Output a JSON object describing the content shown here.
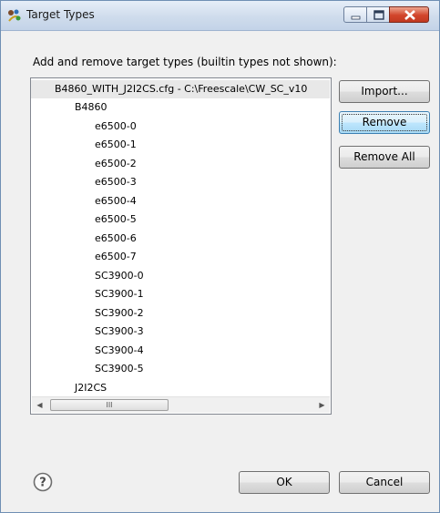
{
  "window": {
    "title": "Target Types"
  },
  "dialog": {
    "description": "Add and remove target types (builtin types not shown):",
    "tree": {
      "root": "B4860_WITH_J2I2CS.cfg - C:\\Freescale\\CW_SC_v10",
      "items": [
        {
          "label": "B4860",
          "level": 1
        },
        {
          "label": "e6500-0",
          "level": 2
        },
        {
          "label": "e6500-1",
          "level": 2
        },
        {
          "label": "e6500-2",
          "level": 2
        },
        {
          "label": "e6500-3",
          "level": 2
        },
        {
          "label": "e6500-4",
          "level": 2
        },
        {
          "label": "e6500-5",
          "level": 2
        },
        {
          "label": "e6500-6",
          "level": 2
        },
        {
          "label": "e6500-7",
          "level": 2
        },
        {
          "label": "SC3900-0",
          "level": 2
        },
        {
          "label": "SC3900-1",
          "level": 2
        },
        {
          "label": "SC3900-2",
          "level": 2
        },
        {
          "label": "SC3900-3",
          "level": 2
        },
        {
          "label": "SC3900-4",
          "level": 2
        },
        {
          "label": "SC3900-5",
          "level": 2
        },
        {
          "label": "J2I2CS",
          "level": 1
        }
      ],
      "scrollbar_thumb_glyph": "III"
    },
    "buttons": {
      "import": "Import...",
      "remove": "Remove",
      "remove_all": "Remove All",
      "ok": "OK",
      "cancel": "Cancel"
    }
  },
  "icons": {
    "title": "application-icon",
    "help": "help-icon"
  }
}
